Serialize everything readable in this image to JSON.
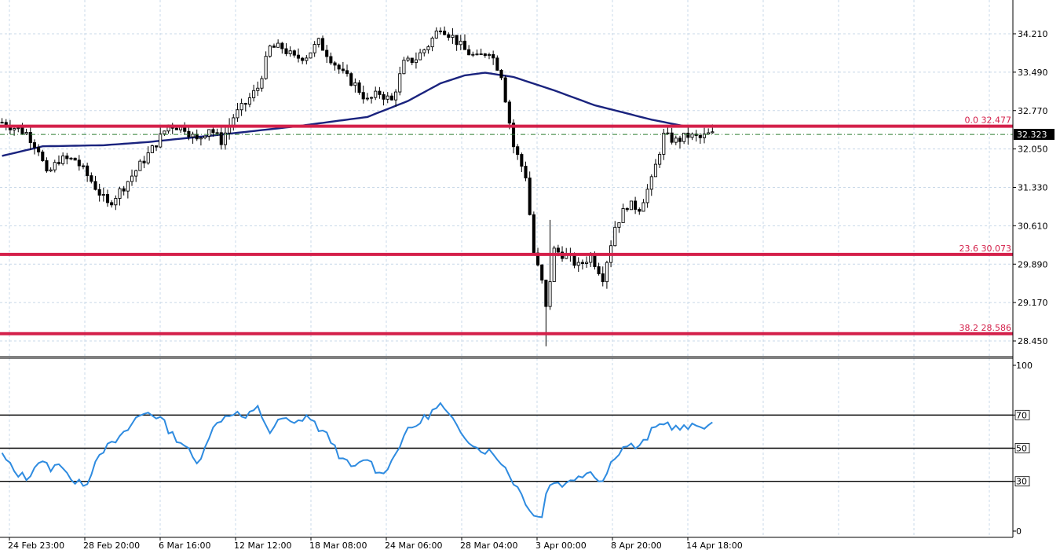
{
  "chart_data": [
    {
      "type": "candlestick",
      "title": "",
      "price_axis": {
        "ticks": [
          "34.210",
          "33.490",
          "32.770",
          "32.050",
          "31.330",
          "30.610",
          "29.890",
          "29.170",
          "28.450"
        ],
        "ylim": [
          28.15,
          34.65
        ]
      },
      "current_price": "32.323",
      "current_price_value": 32.323,
      "fib_levels": [
        {
          "label": "0.0 32.477",
          "value": 32.477
        },
        {
          "label": "23.6 30.073",
          "value": 30.073
        },
        {
          "label": "38.2 28.586",
          "value": 28.586
        }
      ],
      "x_labels": [
        "24 Feb 23:00",
        "28 Feb 20:00",
        "6 Mar 16:00",
        "12 Mar 12:00",
        "18 Mar 08:00",
        "24 Mar 06:00",
        "28 Mar 04:00",
        "3 Apr 00:00",
        "8 Apr 20:00",
        "14 Apr 18:00"
      ],
      "close_path": [
        [
          0,
          32.55
        ],
        [
          6,
          32.35
        ],
        [
          9,
          32.05
        ],
        [
          11,
          31.55
        ],
        [
          14,
          31.85
        ],
        [
          18,
          31.85
        ],
        [
          22,
          31.45
        ],
        [
          26,
          31.0
        ],
        [
          30,
          31.35
        ],
        [
          34,
          31.75
        ],
        [
          37,
          32.05
        ],
        [
          41,
          32.5
        ],
        [
          45,
          32.45
        ],
        [
          48,
          32.2
        ],
        [
          51,
          32.45
        ],
        [
          54,
          32.2
        ],
        [
          57,
          32.65
        ],
        [
          60,
          32.9
        ],
        [
          63,
          33.2
        ],
        [
          66,
          33.95
        ],
        [
          69,
          33.95
        ],
        [
          72,
          33.75
        ],
        [
          75,
          33.8
        ],
        [
          78,
          34.05
        ],
        [
          81,
          33.75
        ],
        [
          84,
          33.45
        ],
        [
          87,
          33.25
        ],
        [
          90,
          32.95
        ],
        [
          93,
          33.1
        ],
        [
          96,
          32.95
        ],
        [
          99,
          33.65
        ],
        [
          102,
          33.75
        ],
        [
          105,
          34.0
        ],
        [
          108,
          34.35
        ],
        [
          111,
          34.15
        ],
        [
          114,
          33.9
        ],
        [
          117,
          33.75
        ],
        [
          120,
          33.9
        ],
        [
          123,
          33.45
        ],
        [
          126,
          32.1
        ],
        [
          129,
          31.55
        ],
        [
          131,
          30.1
        ],
        [
          133,
          29.55
        ],
        [
          134,
          29.05
        ],
        [
          136,
          30.15
        ],
        [
          139,
          30.05
        ],
        [
          142,
          29.85
        ],
        [
          145,
          30.05
        ],
        [
          148,
          29.65
        ],
        [
          151,
          30.6
        ],
        [
          154,
          31.0
        ],
        [
          157,
          30.95
        ],
        [
          160,
          31.45
        ],
        [
          163,
          32.3
        ],
        [
          166,
          32.2
        ],
        [
          169,
          32.3
        ],
        [
          172,
          32.25
        ],
        [
          174,
          32.32
        ]
      ],
      "ma_path": [
        [
          0,
          31.92
        ],
        [
          10,
          32.1
        ],
        [
          25,
          32.12
        ],
        [
          36,
          32.18
        ],
        [
          54,
          32.32
        ],
        [
          72,
          32.47
        ],
        [
          90,
          32.65
        ],
        [
          100,
          32.95
        ],
        [
          108,
          33.28
        ],
        [
          114,
          33.43
        ],
        [
          119,
          33.48
        ],
        [
          126,
          33.4
        ],
        [
          136,
          33.15
        ],
        [
          146,
          32.87
        ],
        [
          160,
          32.6
        ],
        [
          168,
          32.48
        ]
      ]
    },
    {
      "type": "line",
      "title": "",
      "y_ticks": [
        "100",
        "70",
        "50",
        "30",
        "0"
      ],
      "levels": [
        {
          "label": "70",
          "value": 70
        },
        {
          "label": "50",
          "value": 50
        },
        {
          "label": "30",
          "value": 30
        }
      ],
      "ylim": [
        0,
        100
      ],
      "rsi_path": [
        [
          0,
          46
        ],
        [
          3,
          36
        ],
        [
          6,
          32
        ],
        [
          9,
          42
        ],
        [
          12,
          38
        ],
        [
          15,
          40
        ],
        [
          18,
          28
        ],
        [
          21,
          30
        ],
        [
          24,
          48
        ],
        [
          27,
          52
        ],
        [
          30,
          58
        ],
        [
          33,
          68
        ],
        [
          36,
          72
        ],
        [
          39,
          68
        ],
        [
          42,
          58
        ],
        [
          45,
          52
        ],
        [
          48,
          40
        ],
        [
          51,
          58
        ],
        [
          54,
          68
        ],
        [
          57,
          72
        ],
        [
          60,
          68
        ],
        [
          63,
          74
        ],
        [
          66,
          60
        ],
        [
          69,
          68
        ],
        [
          72,
          64
        ],
        [
          75,
          70
        ],
        [
          78,
          62
        ],
        [
          81,
          55
        ],
        [
          84,
          42
        ],
        [
          87,
          38
        ],
        [
          90,
          44
        ],
        [
          93,
          34
        ],
        [
          96,
          42
        ],
        [
          99,
          58
        ],
        [
          102,
          64
        ],
        [
          105,
          70
        ],
        [
          108,
          76
        ],
        [
          111,
          66
        ],
        [
          114,
          58
        ],
        [
          117,
          50
        ],
        [
          120,
          48
        ],
        [
          123,
          42
        ],
        [
          126,
          30
        ],
        [
          129,
          18
        ],
        [
          131,
          10
        ],
        [
          133,
          8
        ],
        [
          134,
          24
        ],
        [
          136,
          30
        ],
        [
          139,
          28
        ],
        [
          142,
          34
        ],
        [
          145,
          36
        ],
        [
          148,
          30
        ],
        [
          151,
          46
        ],
        [
          154,
          52
        ],
        [
          157,
          50
        ],
        [
          160,
          60
        ],
        [
          163,
          66
        ],
        [
          166,
          62
        ],
        [
          169,
          62
        ],
        [
          172,
          64
        ],
        [
          174,
          64
        ]
      ],
      "current": 64
    }
  ],
  "colors": {
    "background": "#ffffff",
    "grid": "#c8d8e8",
    "candle": "#000000",
    "moving_average": "#1a237e",
    "fib_line": "#d4204a",
    "current_price_line": "#2e7d32",
    "rsi_line": "#2e8be0",
    "axis": "#000000"
  }
}
